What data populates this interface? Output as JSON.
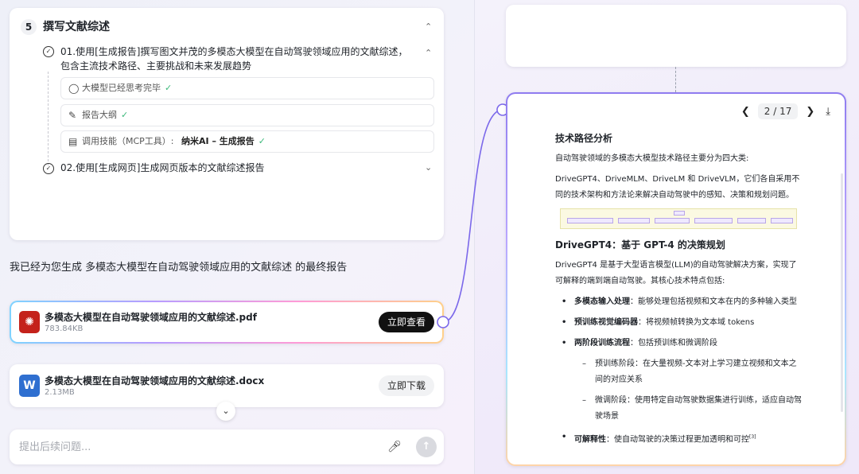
{
  "task": {
    "step_number": "5",
    "step_title": "撰写文献综述",
    "subtask1": {
      "text": "01.使用[生成报告]撰写图文并茂的多模态大模型在自动驾驶领域应用的文献综述，包含主流技术路径、主要挑战和未来发展趋势",
      "items": [
        {
          "label": "大模型已经思考完毕",
          "icon": "lightbulb-icon"
        },
        {
          "label": "报告大纲",
          "icon": "pencil-icon"
        },
        {
          "label": "调用技能（MCP工具）:",
          "extra": "纳米AI – 生成报告",
          "icon": "toolbox-icon"
        }
      ]
    },
    "subtask2": {
      "text": "02.使用[生成网页]生成网页版本的文献综述报告"
    }
  },
  "summary": {
    "prefix": "我已经为您生成 ",
    "topic": "多模态大模型在自动驾驶领域应用的文献综述",
    "suffix": " 的最终报告"
  },
  "files": [
    {
      "name": "多模态大模型在自动驾驶领域应用的文献综述.pdf",
      "size": "783.84KB",
      "icon": "pdf-icon",
      "icon_color": "#c4221b",
      "action": "立即查看"
    },
    {
      "name": "多模态大模型在自动驾驶领域应用的文献综述.docx",
      "size": "2.13MB",
      "icon": "word-icon",
      "icon_label": "W",
      "icon_color": "#2f6fd0",
      "action": "立即下载"
    }
  ],
  "input": {
    "placeholder": "提出后续问题..."
  },
  "viewer": {
    "page_indicator": "2 / 17",
    "section_title": "技术路径分析",
    "intro_line1": "自动驾驶领域的多模态大模型技术路径主要分为四大类:",
    "intro_line2": "DriveGPT4、DriveMLM、DriveLM 和 DriveVLM，它们各自采用不同的技术架构和方法论来解决自动驾驶中的感知、决策和规划问题。",
    "heading2": "DriveGPT4：基于 GPT-4 的决策规划",
    "para": "DriveGPT4 是基于大型语言模型(LLM)的自动驾驶解决方案，实现了可解释的端到端自动驾驶。其核心技术特点包括:",
    "bullets": [
      {
        "bold": "多模态输入处理",
        "text": "：能够处理包括视频和文本在内的多种输入类型"
      },
      {
        "bold": "预训练视觉编码器",
        "text": "：将视频帧转换为文本域 tokens"
      },
      {
        "bold": "两阶段训练流程",
        "text": "：包括预训练和微调阶段"
      }
    ],
    "sub_bullets": [
      "预训练阶段：在大量视频-文本对上学习建立视频和文本之间的对应关系",
      "微调阶段：使用特定自动驾驶数据集进行训练，适应自动驾驶场景"
    ],
    "last_bullet": {
      "bold": "可解释性",
      "text": "：使自动驾驶的决策过程更加透明和可控",
      "sup": "[3]"
    }
  },
  "colors": {
    "accent": "#8f7cf0",
    "success": "#3bb87a",
    "pdf": "#c4221b",
    "word": "#2f6fd0"
  }
}
